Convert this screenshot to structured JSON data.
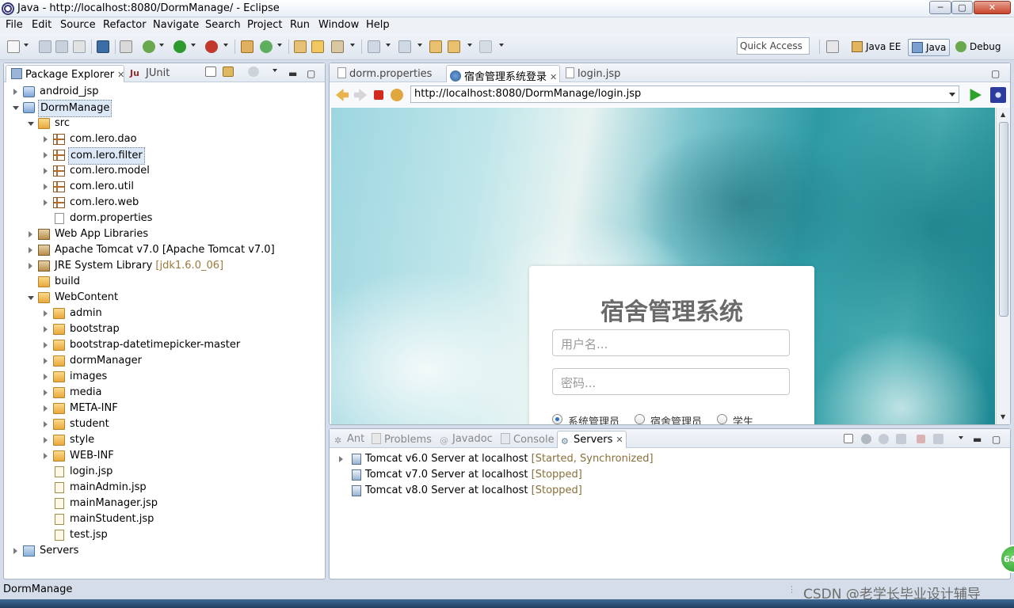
{
  "window": {
    "title": "Java - http://localhost:8080/DormManage/ - Eclipse",
    "minimize": "─",
    "maximize": "▢",
    "close": "✕"
  },
  "menu": [
    "File",
    "Edit",
    "Source",
    "Refactor",
    "Navigate",
    "Search",
    "Project",
    "Run",
    "Window",
    "Help"
  ],
  "toolbar": {
    "quick_access": "Quick Access"
  },
  "perspectives": [
    "Java EE",
    "Java",
    "Debug"
  ],
  "left_panel": {
    "tabs": [
      {
        "label": "Package Explorer",
        "close": "✕"
      },
      {
        "label": "JUnit"
      }
    ],
    "tree": [
      {
        "label": "android_jsp"
      },
      {
        "label": "DormManage"
      },
      {
        "label": "src"
      },
      {
        "label": "com.lero.dao"
      },
      {
        "label": "com.lero.filter"
      },
      {
        "label": "com.lero.model"
      },
      {
        "label": "com.lero.util"
      },
      {
        "label": "com.lero.web"
      },
      {
        "label": "dorm.properties"
      },
      {
        "label": "Web App Libraries"
      },
      {
        "label": "Apache Tomcat v7.0 [Apache Tomcat v7.0]"
      },
      {
        "label": "JRE System Library",
        "decor": "[jdk1.6.0_06]"
      },
      {
        "label": "build"
      },
      {
        "label": "WebContent"
      },
      {
        "label": "admin"
      },
      {
        "label": "bootstrap"
      },
      {
        "label": "bootstrap-datetimepicker-master"
      },
      {
        "label": "dormManager"
      },
      {
        "label": "images"
      },
      {
        "label": "media"
      },
      {
        "label": "META-INF"
      },
      {
        "label": "student"
      },
      {
        "label": "style"
      },
      {
        "label": "WEB-INF"
      },
      {
        "label": "login.jsp"
      },
      {
        "label": "mainAdmin.jsp"
      },
      {
        "label": "mainManager.jsp"
      },
      {
        "label": "mainStudent.jsp"
      },
      {
        "label": "test.jsp"
      },
      {
        "label": "Servers"
      }
    ]
  },
  "editor": {
    "tabs": [
      {
        "label": "dorm.properties"
      },
      {
        "label": "宿舍管理系统登录",
        "close": "✕"
      },
      {
        "label": "login.jsp"
      }
    ],
    "url": "http://localhost:8080/DormManage/login.jsp",
    "login": {
      "title": "宿舍管理系统",
      "username_placeholder": "用户名...",
      "password_placeholder": "密码...",
      "roles": [
        "系统管理员",
        "宿舍管理员",
        "学生"
      ]
    }
  },
  "bottom_panel": {
    "tabs": [
      "Ant",
      "Problems",
      "Javadoc",
      "Console",
      "Servers"
    ],
    "servers_close": "✕",
    "servers": [
      {
        "name": "Tomcat v6.0 Server at localhost",
        "status": "[Started, Synchronized]"
      },
      {
        "name": "Tomcat v7.0 Server at localhost",
        "status": "[Stopped]"
      },
      {
        "name": "Tomcat v8.0 Server at localhost",
        "status": "[Stopped]"
      }
    ]
  },
  "status_bar": {
    "text": "DormManage",
    "watermark": "CSDN @老学长毕业设计辅导",
    "badge": "64"
  }
}
